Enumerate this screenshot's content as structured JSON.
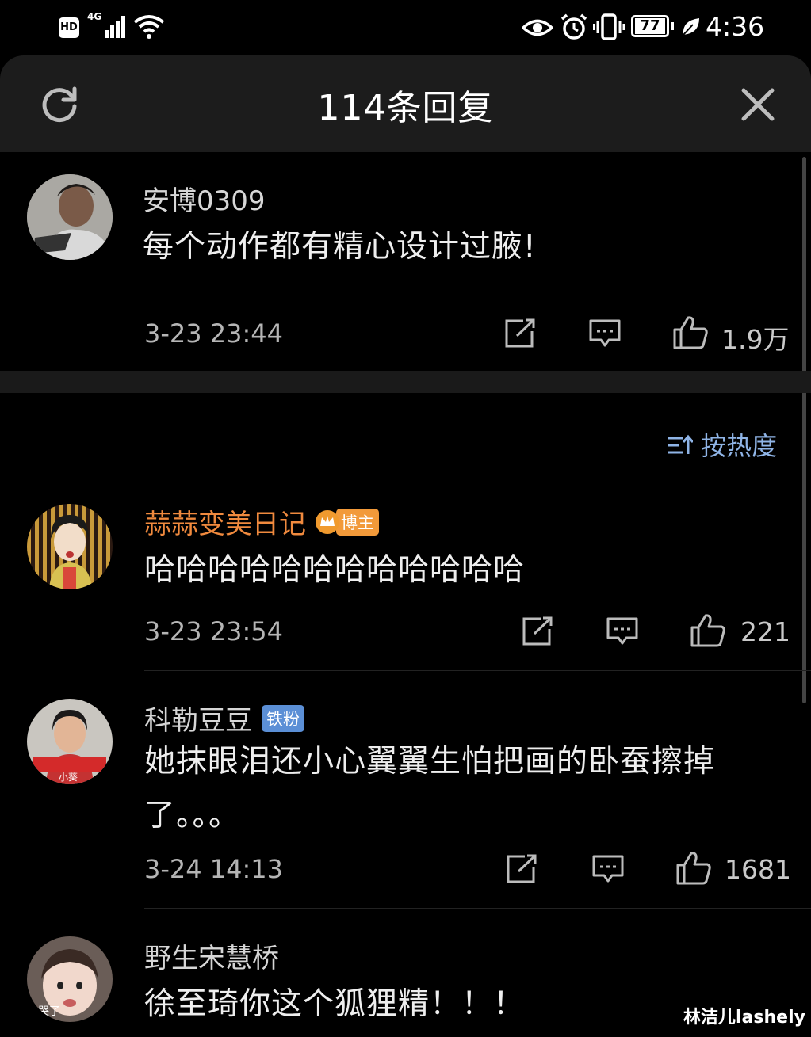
{
  "status_bar": {
    "hd": "HD",
    "network": "4G",
    "battery": "77",
    "time": "4:36"
  },
  "header": {
    "title": "114条回复"
  },
  "main_comment": {
    "username": "安博0309",
    "text": "每个动作都有精心设计过腋!",
    "time": "3-23 23:44",
    "likes": "1.9万"
  },
  "sort": {
    "label": "按热度"
  },
  "replies": [
    {
      "username": "蒜蒜变美日记",
      "badge": "博主",
      "text": "哈哈哈哈哈哈哈哈哈哈哈哈",
      "time": "3-23 23:54",
      "likes": "221"
    },
    {
      "username": "科勒豆豆",
      "badge": "铁粉",
      "text_line1": "她抹眼泪还小心翼翼生怕把画的卧蚕擦掉",
      "text_line2": "了。。。",
      "time": "3-24 14:13",
      "likes": "1681",
      "avatar_caption": "小葵"
    },
    {
      "username": "野生宋慧桥",
      "text": "徐至琦你这个狐狸精！！！",
      "avatar_caption": "哭了"
    }
  ],
  "watermark": "林洁儿lashely",
  "colors": {
    "background": "#000000",
    "header": "#1c1c1c",
    "blogger_name": "#f08a3e",
    "sort_blue": "#8fb4e6",
    "fan_badge": "#5b8fd6"
  }
}
